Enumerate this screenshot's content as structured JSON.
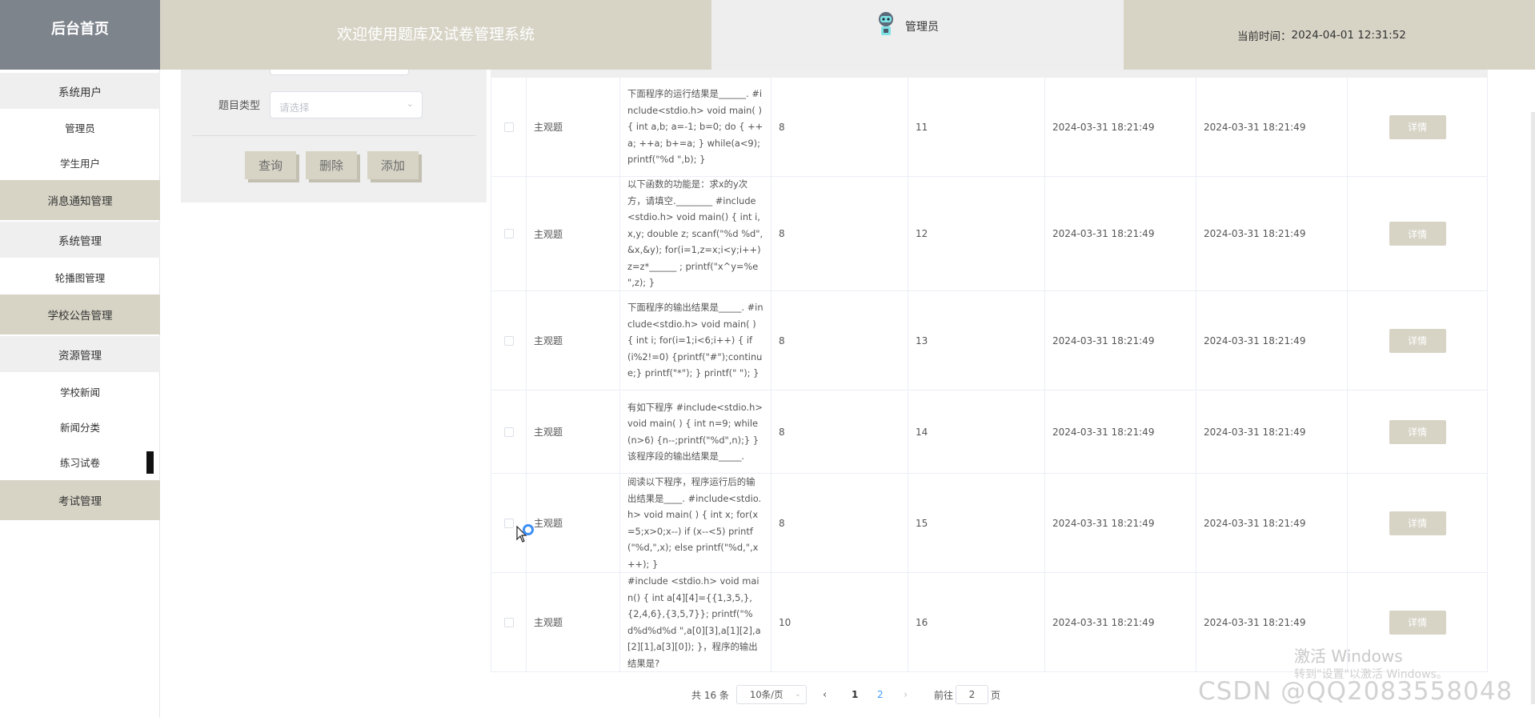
{
  "header": {
    "brand": "后台首页",
    "title": "欢迎使用题库及试卷管理系统",
    "user": "管理员",
    "time_label": "当前时间：",
    "time_value": "2024-04-01 12:31:52"
  },
  "sidebar": {
    "items": [
      {
        "label": "系统用户"
      },
      {
        "label": "管理员"
      },
      {
        "label": "学生用户"
      },
      {
        "label": "消息通知管理"
      },
      {
        "label": "系统管理"
      },
      {
        "label": "轮播图管理"
      },
      {
        "label": "学校公告管理"
      },
      {
        "label": "资源管理"
      },
      {
        "label": "学校新闻"
      },
      {
        "label": "新闻分类"
      },
      {
        "label": "练习试卷"
      },
      {
        "label": "考试管理"
      }
    ]
  },
  "search": {
    "type_label": "题目类型",
    "type_placeholder": "请选择",
    "query": "查询",
    "delete": "删除",
    "add": "添加"
  },
  "table": {
    "detail_label": "详情",
    "rows": [
      {
        "type": "主观题",
        "question": "下面程序的运行结果是______. #include<stdio.h> void main( ) { int a,b; a=-1; b=0; do { ++a; ++a; b+=a; } while(a<9); printf(\"%d \",b); }",
        "score": "8",
        "num": "11",
        "created": "2024-03-31 18:21:49",
        "updated": "2024-03-31 18:21:49"
      },
      {
        "type": "主观题",
        "question": "以下函数的功能是：求x的y次方，请填空.________ #include<stdio.h> void main() { int i,x,y; double z; scanf(\"%d %d\",&x,&y); for(i=1,z=x;i<y;i++) z=z*______ ; printf(\"x^y=%e \",z); }",
        "score": "8",
        "num": "12",
        "created": "2024-03-31 18:21:49",
        "updated": "2024-03-31 18:21:49"
      },
      {
        "type": "主观题",
        "question": "下面程序的输出结果是_____. #include<stdio.h> void main( ) { int i; for(i=1;i<6;i++) { if (i%2!=0) {printf(\"#\");continue;} printf(\"*\"); } printf(\" \"); }",
        "score": "8",
        "num": "13",
        "created": "2024-03-31 18:21:49",
        "updated": "2024-03-31 18:21:49"
      },
      {
        "type": "主观题",
        "question": "有如下程序 #include<stdio.h> void main( ) { int n=9; while(n>6) {n--;printf(\"%d\",n);} } 该程序段的输出结果是_____.",
        "score": "8",
        "num": "14",
        "created": "2024-03-31 18:21:49",
        "updated": "2024-03-31 18:21:49"
      },
      {
        "type": "主观题",
        "question": "阅读以下程序，程序运行后的输出结果是____. #include<stdio.h> void main( ) { int x; for(x=5;x>0;x--) if (x--<5) printf(\"%d,\",x); else printf(\"%d,\",x++); }",
        "score": "8",
        "num": "15",
        "created": "2024-03-31 18:21:49",
        "updated": "2024-03-31 18:21:49"
      },
      {
        "type": "主观题",
        "question": "#include <stdio.h> void main() { int a[4][4]={{1,3,5,},{2,4,6},{3,5,7}}; printf(\"%d%d%d%d \",a[0][3],a[1][2],a[2][1],a[3][0]); }，程序的输出结果是?",
        "score": "10",
        "num": "16",
        "created": "2024-03-31 18:21:49",
        "updated": "2024-03-31 18:21:49"
      }
    ]
  },
  "pagination": {
    "total": "共 16 条",
    "page_size": "10条/页",
    "prev": "‹",
    "page1": "1",
    "page2": "2",
    "next": "›",
    "goto": "前往",
    "current": "2",
    "page_unit": "页"
  },
  "watermarks": {
    "windows_title": "激活 Windows",
    "windows_sub": "转到\"设置\"以激活 Windows。",
    "csdn": "CSDN @QQ2083558048"
  },
  "colors": {
    "accent_beige": "#d7d4c6",
    "brand_gray": "#7e848c",
    "panel_gray": "#efefef"
  }
}
